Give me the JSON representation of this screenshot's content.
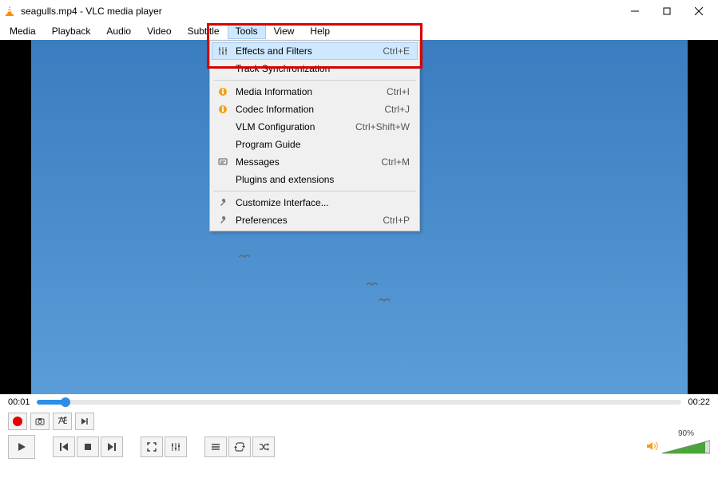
{
  "window": {
    "title": "seagulls.mp4 - VLC media player"
  },
  "menubar": [
    "Media",
    "Playback",
    "Audio",
    "Video",
    "Subtitle",
    "Tools",
    "View",
    "Help"
  ],
  "active_menu": "Tools",
  "dropdown": {
    "items": [
      {
        "icon": "sliders",
        "label": "Effects and Filters",
        "shortcut": "Ctrl+E",
        "highlight": true
      },
      {
        "icon": "",
        "label": "Track Synchronization",
        "shortcut": ""
      },
      {
        "sep": true
      },
      {
        "icon": "info",
        "label": "Media Information",
        "shortcut": "Ctrl+I"
      },
      {
        "icon": "info",
        "label": "Codec Information",
        "shortcut": "Ctrl+J"
      },
      {
        "icon": "",
        "label": "VLM Configuration",
        "shortcut": "Ctrl+Shift+W"
      },
      {
        "icon": "",
        "label": "Program Guide",
        "shortcut": ""
      },
      {
        "icon": "msg",
        "label": "Messages",
        "shortcut": "Ctrl+M"
      },
      {
        "icon": "",
        "label": "Plugins and extensions",
        "shortcut": ""
      },
      {
        "sep": true
      },
      {
        "icon": "wrench",
        "label": "Customize Interface...",
        "shortcut": ""
      },
      {
        "icon": "wrench",
        "label": "Preferences",
        "shortcut": "Ctrl+P"
      }
    ]
  },
  "playback": {
    "current_time": "00:01",
    "total_time": "00:22",
    "volume_percent": "90%"
  }
}
